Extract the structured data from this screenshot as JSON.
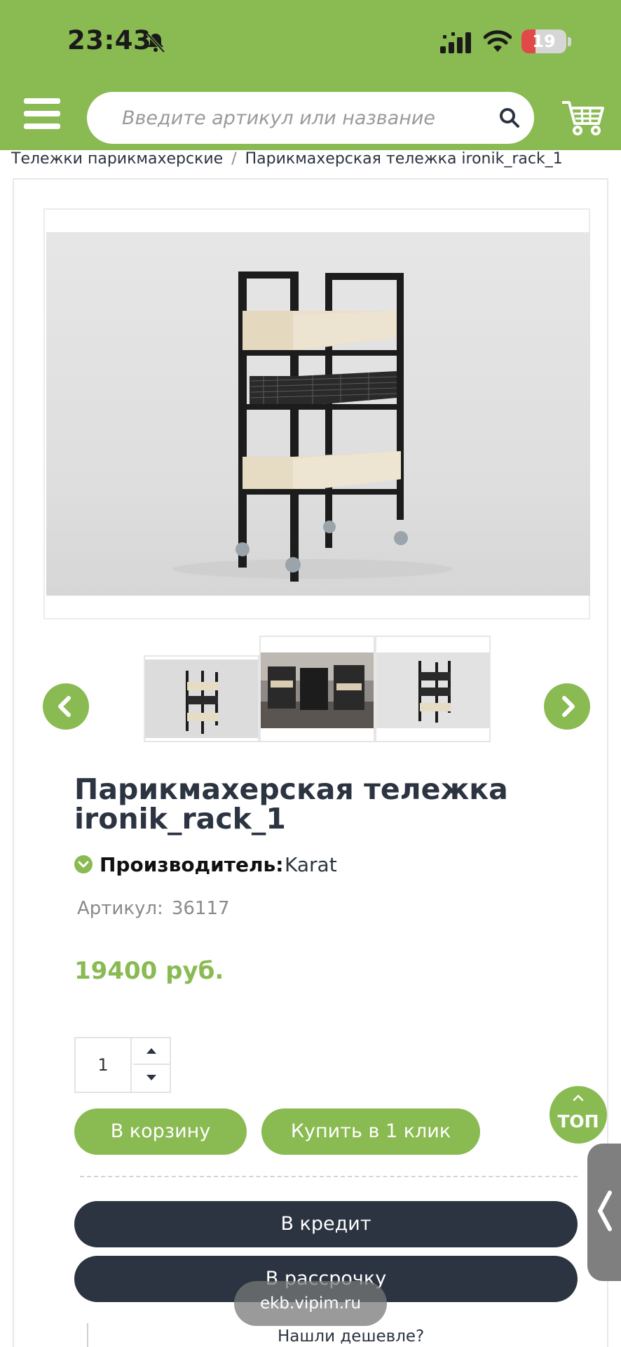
{
  "status_bar": {
    "time": "23:43",
    "battery": "19",
    "icons": [
      "bell-slash-icon",
      "signal-icon",
      "wifi-icon",
      "battery-icon"
    ]
  },
  "header": {
    "search_placeholder": "Введите артикул или название",
    "icons": [
      "hamburger-menu-icon",
      "search-icon",
      "cart-icon"
    ]
  },
  "breadcrumb": {
    "category": "Тележки парикмахерские",
    "separator": "/",
    "current": "Парикмахерская тележка ironik_rack_1"
  },
  "gallery": {
    "thumbnails": [
      "thumb-1",
      "thumb-2",
      "thumb-3"
    ],
    "icons": [
      "chevron-left-icon",
      "chevron-right-icon"
    ]
  },
  "product": {
    "title": "Парикмахерская тележка ironik_rack_1",
    "manufacturer_label": "Производитель:",
    "manufacturer": "Karat",
    "sku_label": "Артикул:",
    "sku": "36117",
    "price": "19400 руб.",
    "quantity": "1"
  },
  "actions": {
    "add_to_cart": "В корзину",
    "buy_one_click": "Купить в 1 клик",
    "credit": "В кредит",
    "installment": "В рассрочку",
    "found_cheaper": "Нашли дешевле?",
    "top": "ТОП"
  },
  "browser": {
    "url": "ekb.vipim.ru"
  },
  "colors": {
    "brand_green": "#8aba52",
    "dark": "#2b3440"
  }
}
